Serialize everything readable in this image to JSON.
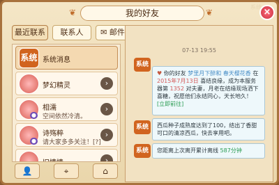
{
  "window": {
    "title": "我的好友",
    "corner_label": "系统",
    "close_symbol": "×"
  },
  "tabs": [
    {
      "label": "最近联系"
    },
    {
      "label": "联系人"
    },
    {
      "label": "邮件"
    }
  ],
  "contacts": [
    {
      "name": "系统消息",
      "subtitle": "",
      "avatar_text": "系统",
      "type": "system"
    },
    {
      "name": "梦幻精灵",
      "subtitle": "",
      "avatar_text": "",
      "type": "friend"
    },
    {
      "name": "相濡",
      "subtitle": "空间依然冷清。",
      "avatar_text": "",
      "type": "friend"
    },
    {
      "name": "诗殇粹",
      "subtitle": "请大家多多关注！[?]",
      "avatar_text": "",
      "type": "friend"
    },
    {
      "name": "旧情愫",
      "subtitle": "",
      "avatar_text": "",
      "type": "friend"
    }
  ],
  "chat": {
    "timestamp": "07-13 19:55",
    "messages": [
      {
        "sender": "系统",
        "text_parts": [
          "你的好友",
          "梦里月下醉和",
          "春天樱花香",
          "在",
          "2015年7月13日",
          "喜结良缘，成为本服务器第",
          "1352",
          "对夫妻，月老在结缘现场洒下喜糖，祝愿他们永结同心，天长地久！",
          "[立即前往]"
        ]
      },
      {
        "sender": "系统",
        "text": "西瓜种子成熟度达到了100，结出了香甜可口的清凉西瓜，快去享用吧。"
      },
      {
        "sender": "系统",
        "text_parts": [
          "您距离上次离开累计离线",
          "587分钟"
        ]
      }
    ]
  },
  "bottom_buttons": [
    {
      "icon": "add-friend-icon"
    },
    {
      "icon": "location-icon"
    },
    {
      "icon": "home-icon"
    }
  ],
  "colors": {
    "frame": "#a8723d",
    "accent": "#d1641f",
    "highlight_blue": "#4b8fc7",
    "highlight_red": "#d45a5a",
    "highlight_green": "#2a9c52"
  }
}
